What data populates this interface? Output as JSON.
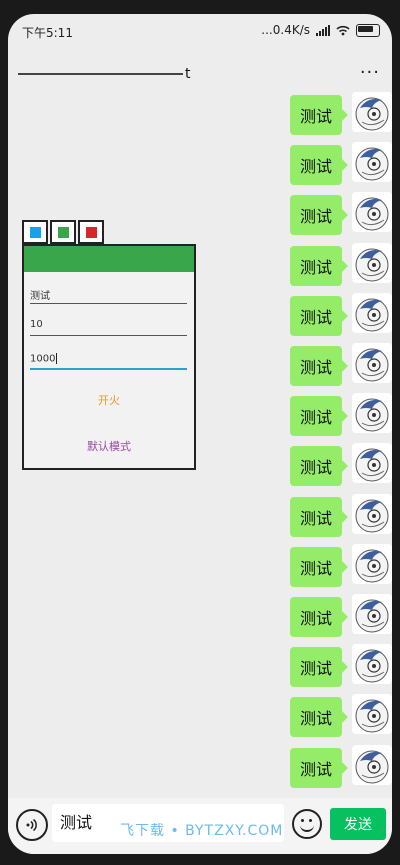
{
  "status_bar": {
    "time": "下午5:11",
    "network_speed": "...0.4K/s"
  },
  "header": {
    "title_suffix": "t",
    "more_label": "···"
  },
  "messages": [
    {
      "text": "测试"
    },
    {
      "text": "测试"
    },
    {
      "text": "测试"
    },
    {
      "text": "测试"
    },
    {
      "text": "测试"
    },
    {
      "text": "测试"
    },
    {
      "text": "测试"
    },
    {
      "text": "测试"
    },
    {
      "text": "测试"
    },
    {
      "text": "测试"
    },
    {
      "text": "测试"
    },
    {
      "text": "测试"
    },
    {
      "text": "测试"
    },
    {
      "text": "测试"
    }
  ],
  "panel": {
    "tab_colors": [
      "#1aa2e6",
      "#3aa64b",
      "#d9262b"
    ],
    "header_color": "#3aa64b",
    "fields": [
      {
        "value": "测试"
      },
      {
        "value": "10"
      },
      {
        "value": "1000"
      }
    ],
    "fire_button": {
      "label": "开火",
      "color": "#e39b2f"
    },
    "mode_button": {
      "label": "默认模式",
      "color": "#9b4aa8"
    }
  },
  "input_bar": {
    "text": "测试",
    "send_label": "发送"
  },
  "watermark": "飞下载 • BYTZXY.COM"
}
